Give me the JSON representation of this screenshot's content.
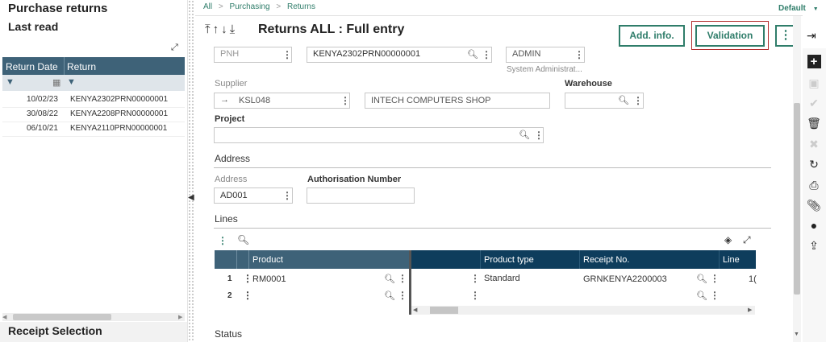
{
  "left_panel": {
    "title": "Purchase returns",
    "subtitle": "Last read",
    "columns": [
      "Return Date",
      "Return"
    ],
    "rows": [
      {
        "date": "10/02/23",
        "return": "KENYA2302PRN00000001"
      },
      {
        "date": "30/08/22",
        "return": "KENYA2208PRN00000001"
      },
      {
        "date": "06/10/21",
        "return": "KENYA2110PRN00000001"
      }
    ],
    "footer": "Receipt Selection"
  },
  "breadcrumb": {
    "all": "All",
    "sep": ">",
    "purchasing": "Purchasing",
    "returns": "Returns"
  },
  "header": {
    "default_label": "Default",
    "title": "Returns ALL : Full entry",
    "add_info": "Add. info.",
    "validation": "Validation",
    "nav_arrows": "⤒↑↓⤓"
  },
  "form": {
    "site_value": "PNH",
    "return_no": "KENYA2302PRN00000001",
    "user_value": "ADMIN",
    "user_desc": "System Administrat...",
    "supplier_label": "Supplier",
    "supplier_code": "KSL048",
    "supplier_name": "INTECH COMPUTERS SHOP",
    "warehouse_label": "Warehouse",
    "project_label": "Project",
    "address_section": "Address",
    "address_label": "Address",
    "address_value": "AD001",
    "auth_label": "Authorisation Number",
    "lines_section": "Lines",
    "status_section": "Status"
  },
  "lines": {
    "columns": {
      "product": "Product",
      "product_type": "Product type",
      "receipt_no": "Receipt No.",
      "line": "Line"
    },
    "rows": [
      {
        "num": "1",
        "product": "RM0001",
        "product_type": "Standard",
        "receipt_no": "GRNKENYA2200003",
        "line": "1("
      },
      {
        "num": "2",
        "product": "",
        "product_type": "",
        "receipt_no": "",
        "line": ""
      }
    ]
  },
  "colors": {
    "accent": "#2f7d6a",
    "grid_header": "#3e6278",
    "dark_header": "#0e3d5c",
    "highlight": "#b22d2d"
  }
}
